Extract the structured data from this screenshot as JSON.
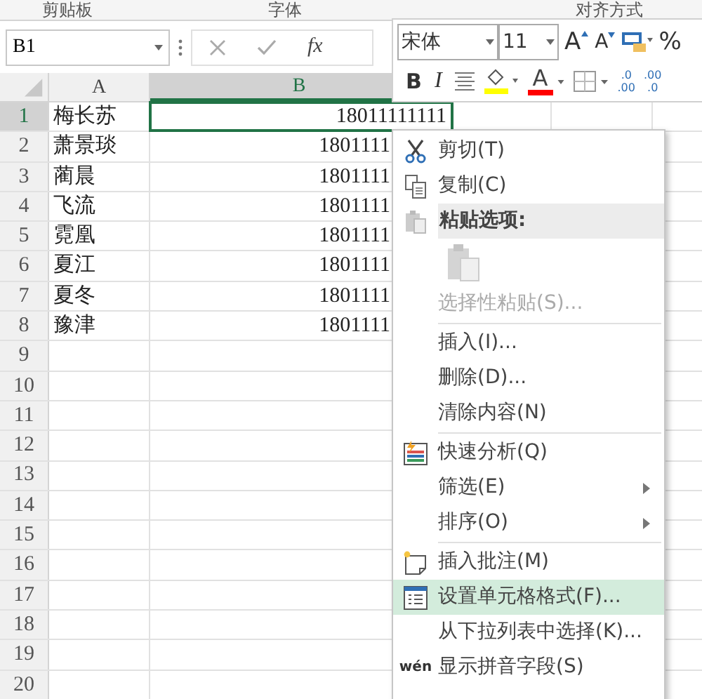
{
  "ribbon_groups": [
    "剪贴板",
    "字体",
    "对齐方式"
  ],
  "formula_bar": {
    "name_box": "B1",
    "fx": "fx"
  },
  "columns": [
    {
      "label": "A",
      "selected": false
    },
    {
      "label": "B",
      "selected": true
    }
  ],
  "rows": [
    {
      "number": "1",
      "name": "梅长苏",
      "phone": "18011111111",
      "selected": true
    },
    {
      "number": "2",
      "name": "萧景琰",
      "phone": "1801111",
      "selected": false
    },
    {
      "number": "3",
      "name": "蔺晨",
      "phone": "1801111",
      "selected": false
    },
    {
      "number": "4",
      "name": "飞流",
      "phone": "1801111",
      "selected": false
    },
    {
      "number": "5",
      "name": "霓凰",
      "phone": "1801111",
      "selected": false
    },
    {
      "number": "6",
      "name": "夏江",
      "phone": "1801111",
      "selected": false
    },
    {
      "number": "7",
      "name": "夏冬",
      "phone": "1801111",
      "selected": false
    },
    {
      "number": "8",
      "name": "豫津",
      "phone": "1801111",
      "selected": false
    },
    {
      "number": "9"
    },
    {
      "number": "10"
    },
    {
      "number": "11"
    },
    {
      "number": "12"
    },
    {
      "number": "13"
    },
    {
      "number": "14"
    },
    {
      "number": "15"
    },
    {
      "number": "16"
    },
    {
      "number": "17"
    },
    {
      "number": "18"
    },
    {
      "number": "19"
    },
    {
      "number": "20"
    }
  ],
  "mini_toolbar": {
    "font": "宋体",
    "size": "11",
    "grow": "A",
    "shrink": "A",
    "percent": "%",
    "bold": "B",
    "italic": "I",
    "font_color": "A",
    "increase_decimal": [
      ".0",
      ".00"
    ],
    "decrease_decimal": [
      ".00",
      ".0"
    ]
  },
  "context_menu": [
    {
      "kind": "cut",
      "label": "剪切(T)",
      "selected": false,
      "disabled": false
    },
    {
      "kind": "copy",
      "label": "复制(C)",
      "selected": false,
      "disabled": false
    },
    {
      "kind": "header",
      "label": "粘贴选项:"
    },
    {
      "kind": "paste_icons"
    },
    {
      "kind": "item",
      "label": "选择性粘贴(S)...",
      "selected": false,
      "disabled": true
    },
    {
      "kind": "separator"
    },
    {
      "kind": "item",
      "label": "插入(I)...",
      "selected": false,
      "disabled": false
    },
    {
      "kind": "item",
      "label": "删除(D)...",
      "selected": false,
      "disabled": false
    },
    {
      "kind": "item",
      "label": "清除内容(N)",
      "selected": false,
      "disabled": false
    },
    {
      "kind": "separator"
    },
    {
      "kind": "analysis",
      "label": "快速分析(Q)",
      "selected": false,
      "disabled": false
    },
    {
      "kind": "submenu",
      "label": "筛选(E)",
      "selected": false,
      "disabled": false
    },
    {
      "kind": "submenu",
      "label": "排序(O)",
      "selected": false,
      "disabled": false
    },
    {
      "kind": "separator"
    },
    {
      "kind": "note",
      "label": "插入批注(M)",
      "selected": false,
      "disabled": false
    },
    {
      "kind": "format",
      "label": "设置单元格格式(F)...",
      "selected": true,
      "disabled": false
    },
    {
      "kind": "item",
      "label": "从下拉列表中选择(K)...",
      "selected": false,
      "disabled": false
    },
    {
      "kind": "pinyin",
      "badge": "wén",
      "label": "显示拼音字段(S)",
      "selected": false,
      "disabled": false
    }
  ]
}
